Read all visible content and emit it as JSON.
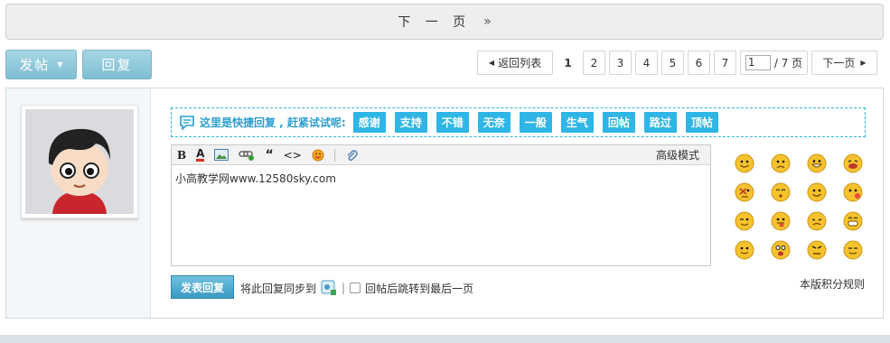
{
  "nextbar": {
    "label": "下 一 页",
    "arrow": "»"
  },
  "actions": {
    "post_label": "发帖",
    "post_caret": "▼",
    "reply_label": "回复"
  },
  "pager": {
    "back_label": "返回列表",
    "back_arrow": "◀",
    "pages": [
      "1",
      "2",
      "3",
      "4",
      "5",
      "6",
      "7"
    ],
    "current": "1",
    "jump_value": "1",
    "jump_total": "/ 7 页",
    "next_label": "下一页",
    "next_arrow": "▶"
  },
  "quick": {
    "prompt": "这里是快捷回复 , 赶紧试试呢:",
    "buttons": [
      "感谢",
      "支持",
      "不错",
      "无奈",
      "一般",
      "生气",
      "回帖",
      "路过",
      "顶帖"
    ]
  },
  "editor": {
    "toolbar": {
      "bold": "B",
      "fontcolor": "A",
      "quote": "“",
      "code": "<>",
      "advanced": "高级模式"
    },
    "content": "小高教学网www.12580sky.com"
  },
  "footer": {
    "submit_label": "发表回复",
    "sync_label": "将此回复同步到",
    "sep": "|",
    "jump_label": "回帖后跳转到最后一页",
    "rules_label": "本版积分规则"
  },
  "colors": {
    "accent": "#2fb5e6",
    "button": "#7ebfd2",
    "smiley": "#f6c22d"
  }
}
